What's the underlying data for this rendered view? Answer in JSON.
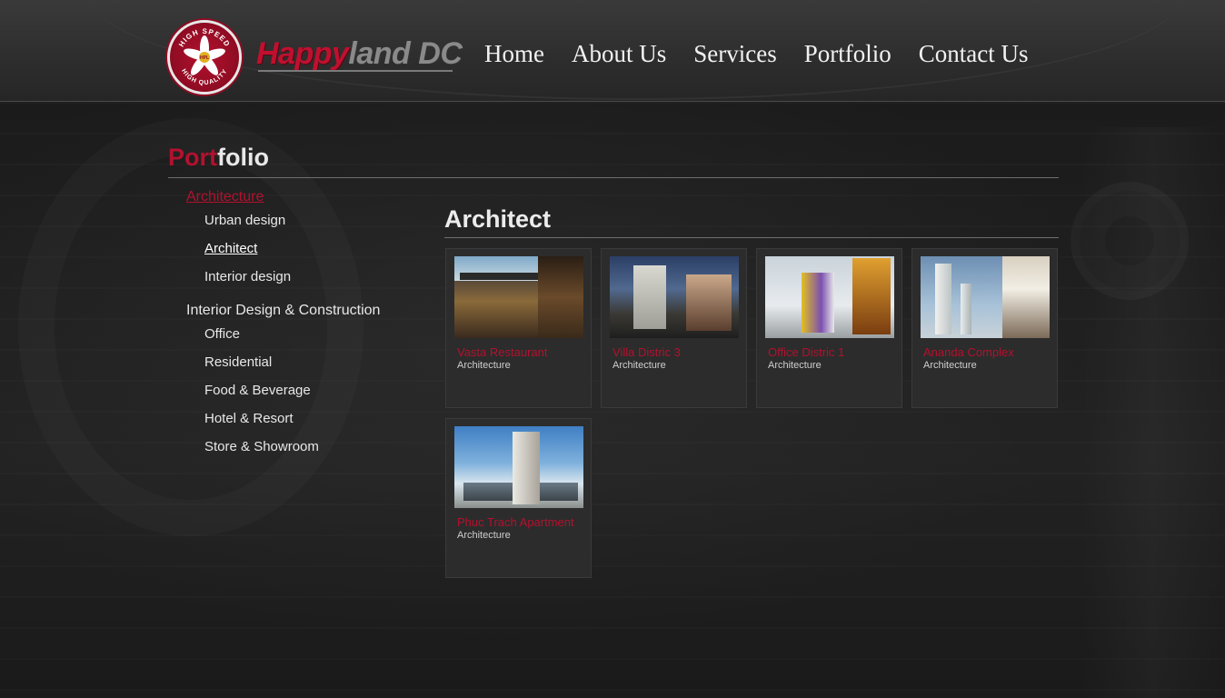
{
  "header": {
    "logo_text_red": "Happy",
    "logo_text_grey": "land DC",
    "badge_top": "HIGH SPEED",
    "badge_bottom": "HIGH QUALITY",
    "badge_center": "HPL",
    "nav": [
      "Home",
      "About Us",
      "Services",
      "Portfolio",
      "Contact Us"
    ]
  },
  "page": {
    "title_accent": "Port",
    "title_rest": "folio"
  },
  "sidebar": {
    "groups": [
      {
        "label": "Architecture",
        "active": true,
        "items": [
          {
            "label": "Urban design",
            "active": false
          },
          {
            "label": "Architect",
            "active": true
          },
          {
            "label": "Interior design",
            "active": false
          }
        ]
      },
      {
        "label": "Interior Design & Construction",
        "active": false,
        "items": [
          {
            "label": "Office",
            "active": false
          },
          {
            "label": "Residential",
            "active": false
          },
          {
            "label": "Food & Beverage",
            "active": false
          },
          {
            "label": "Hotel & Resort",
            "active": false
          },
          {
            "label": "Store & Showroom",
            "active": false
          }
        ]
      }
    ]
  },
  "content": {
    "section_title": "Architect",
    "cards": [
      {
        "title": "Vasta Restaurant",
        "category": "Architecture"
      },
      {
        "title": "Villa Distric 3",
        "category": "Architecture"
      },
      {
        "title": "Office Distric 1",
        "category": "Architecture"
      },
      {
        "title": "Ananda Complex",
        "category": "Architecture"
      },
      {
        "title": "Phuc Trach Apartment",
        "category": "Architecture"
      }
    ]
  },
  "colors": {
    "accent": "#b3112e",
    "background": "#1c1c1c",
    "card": "#2c2c2c"
  }
}
